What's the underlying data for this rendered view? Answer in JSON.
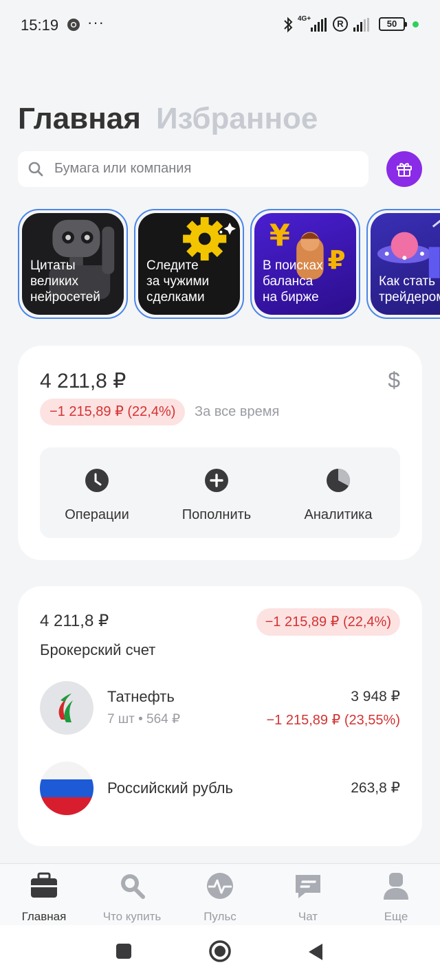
{
  "status_bar": {
    "time": "15:19",
    "more": "···",
    "network": "4G+",
    "roaming": "R",
    "battery": "50"
  },
  "header": {
    "tabs": [
      {
        "label": "Главная",
        "active": true
      },
      {
        "label": "Избранное",
        "active": false
      }
    ]
  },
  "search": {
    "placeholder": "Бумага или компания"
  },
  "stories": [
    {
      "title": "Цитаты\nвеликих\nнейросетей",
      "icon": "robot-art"
    },
    {
      "title": "Следите\nза чужими\nсделками",
      "icon": "gear-art"
    },
    {
      "title": "В поисках\nбаланса\nна бирже",
      "icon": "currency-art"
    },
    {
      "title": "Как стать\nтрейдером",
      "icon": "ufo-art"
    }
  ],
  "summary": {
    "total": "4 211,8 ₽",
    "currency_symbol": "$",
    "change": "−1 215,89 ₽ (22,4%)",
    "period": "За все время",
    "actions": [
      {
        "label": "Операции",
        "icon": "clock-icon"
      },
      {
        "label": "Пополнить",
        "icon": "plus-icon"
      },
      {
        "label": "Аналитика",
        "icon": "pie-icon"
      }
    ]
  },
  "account": {
    "value": "4 211,8 ₽",
    "change": "−1 215,89 ₽ (22,4%)",
    "name": "Брокерский счет",
    "assets": [
      {
        "name": "Татнефть",
        "sub": "7 шт • 564 ₽",
        "value": "3 948 ₽",
        "change": "−1 215,89 ₽ (23,55%)",
        "icon": "tatneft-logo"
      },
      {
        "name": "Российский рубль",
        "sub": "",
        "value": "263,8 ₽",
        "change": "",
        "icon": "russian-flag"
      }
    ]
  },
  "bottom_nav": [
    {
      "label": "Главная",
      "icon": "briefcase-icon",
      "active": true
    },
    {
      "label": "Что купить",
      "icon": "search-icon",
      "active": false
    },
    {
      "label": "Пульс",
      "icon": "pulse-icon",
      "active": false
    },
    {
      "label": "Чат",
      "icon": "chat-icon",
      "active": false
    },
    {
      "label": "Еще",
      "icon": "profile-icon",
      "active": false
    }
  ],
  "colors": {
    "accent": "#8a2be8",
    "negative": "#d33333",
    "negative_bg": "#fde2e2",
    "story_border": "#4a86e8"
  }
}
